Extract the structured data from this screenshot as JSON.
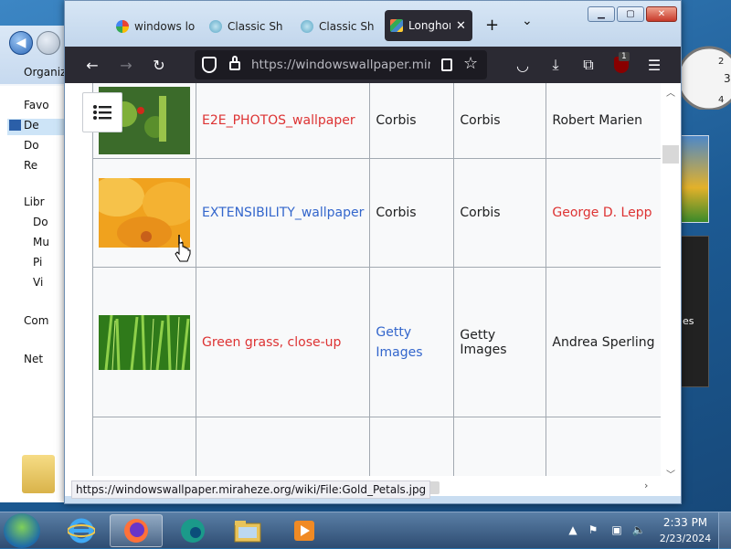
{
  "browser": {
    "tabs": [
      {
        "label": "windows lo",
        "favicon": "google-icon"
      },
      {
        "label": "Classic She",
        "favicon": "shell-icon"
      },
      {
        "label": "Classic She",
        "favicon": "shell-icon"
      },
      {
        "label": "Longhor",
        "favicon": "wallpaper-icon",
        "active": true
      }
    ],
    "new_tab": "+",
    "url": "https://windowswallpaper.mirahe",
    "extension_badge": "1",
    "status_url": "https://windowswallpaper.miraheze.org/wiki/File:Gold_Petals.jpg"
  },
  "table": {
    "rows": [
      {
        "title": "E2E_PHOTOS_wallpaper",
        "title_link": "red",
        "col2": "Corbis",
        "col2_link": "",
        "col3": "Corbis",
        "col4": "Robert Marien",
        "col4_link": ""
      },
      {
        "title": "EXTENSIBILITY_wallpaper",
        "title_link": "blue",
        "col2": "Corbis",
        "col2_link": "",
        "col3": "Corbis",
        "col4": "George D. Lepp",
        "col4_link": "red"
      },
      {
        "title": "Green grass, close-up",
        "title_link": "red",
        "col2": "Getty Images",
        "col2_link": "blue",
        "col3": "Getty Images",
        "col4": "Andrea Sperling",
        "col4_link": ""
      }
    ]
  },
  "explorer": {
    "organize": "Organiz",
    "items": [
      "Favo",
      "De",
      "Do",
      "Re",
      "Libr",
      "Do",
      "Mu",
      "Pi",
      "Vi",
      "Com",
      "Net"
    ]
  },
  "gadget": {
    "dark_text": "es"
  },
  "taskbar": {
    "time": "2:33 PM",
    "date": "2/23/2024"
  },
  "colors": {
    "link_red": "#d33",
    "link_blue": "#3366cc",
    "toolbar": "#2b2a33"
  }
}
